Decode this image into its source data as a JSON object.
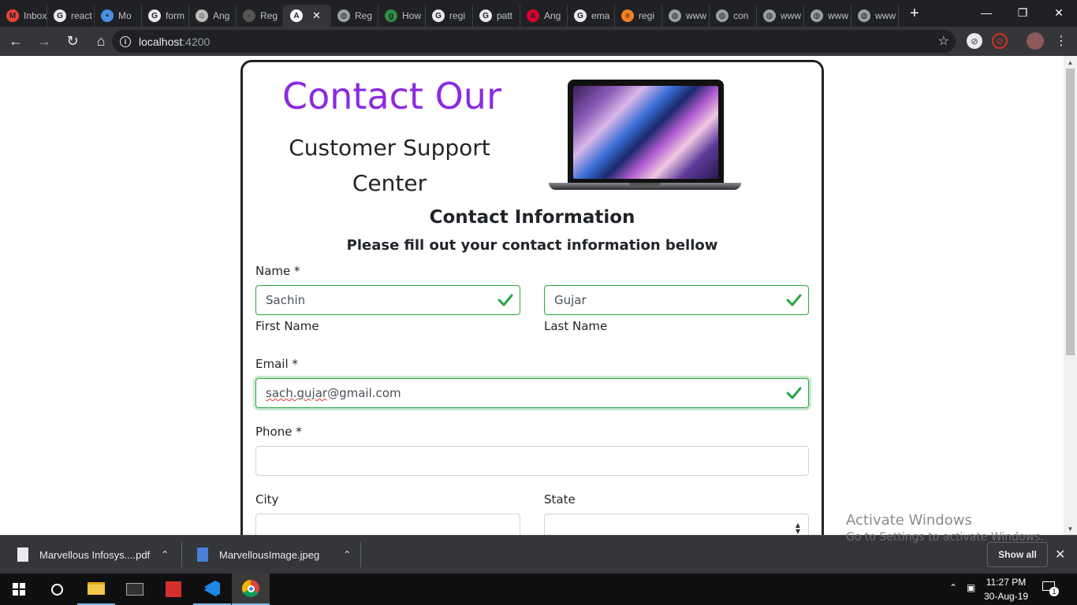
{
  "browser": {
    "tabs": [
      {
        "title": "Inbox",
        "icon": "gmail-icon"
      },
      {
        "title": "react",
        "icon": "google-icon"
      },
      {
        "title": "Mo",
        "icon": "app-icon"
      },
      {
        "title": "form",
        "icon": "google-icon"
      },
      {
        "title": "Ang",
        "icon": "avatar-icon"
      },
      {
        "title": "Reg",
        "icon": "page-icon"
      },
      {
        "title": "A",
        "icon": "angular-icon",
        "active": true
      },
      {
        "title": "Reg",
        "icon": "globe-icon"
      },
      {
        "title": "How",
        "icon": "gfg-icon"
      },
      {
        "title": "regi",
        "icon": "google-icon"
      },
      {
        "title": "patt",
        "icon": "google-icon"
      },
      {
        "title": "Ang",
        "icon": "angular-icon"
      },
      {
        "title": "ema",
        "icon": "google-icon"
      },
      {
        "title": "regi",
        "icon": "stackoverflow-icon"
      },
      {
        "title": "www",
        "icon": "globe-icon"
      },
      {
        "title": "con",
        "icon": "globe-icon"
      },
      {
        "title": "www",
        "icon": "globe-icon"
      },
      {
        "title": "www",
        "icon": "globe-icon"
      },
      {
        "title": "www",
        "icon": "globe-icon"
      }
    ],
    "new_tab": "+",
    "url_host": "localhost",
    "url_port": ":4200"
  },
  "page": {
    "heading_line1": "Contact Our",
    "heading_line2": "Customer Support",
    "heading_line3": "Center",
    "section_title": "Contact Information",
    "section_subtitle": "Please fill out your contact information bellow",
    "name_label": "Name *",
    "first_name_value": "Sachin",
    "first_name_caption": "First Name",
    "last_name_value": "Gujar",
    "last_name_caption": "Last Name",
    "email_label": "Email *",
    "email_value_misspelled": "sach.gujar",
    "email_value_rest": "@gmail.com",
    "phone_label": "Phone *",
    "phone_value": "",
    "city_label": "City",
    "city_value": "",
    "state_label": "State",
    "state_value": "",
    "colors": {
      "heading": "#8a2be2",
      "valid": "#28a745"
    }
  },
  "downloads": {
    "items": [
      {
        "name": "Marvellous Infosys....pdf"
      },
      {
        "name": "MarvellousImage.jpeg"
      }
    ],
    "show_all": "Show all"
  },
  "watermark": {
    "line1": "Activate Windows",
    "line2": "Go to Settings to activate Windows."
  },
  "taskbar": {
    "time": "11:27 PM",
    "date": "30-Aug-19",
    "notification_count": "1"
  }
}
